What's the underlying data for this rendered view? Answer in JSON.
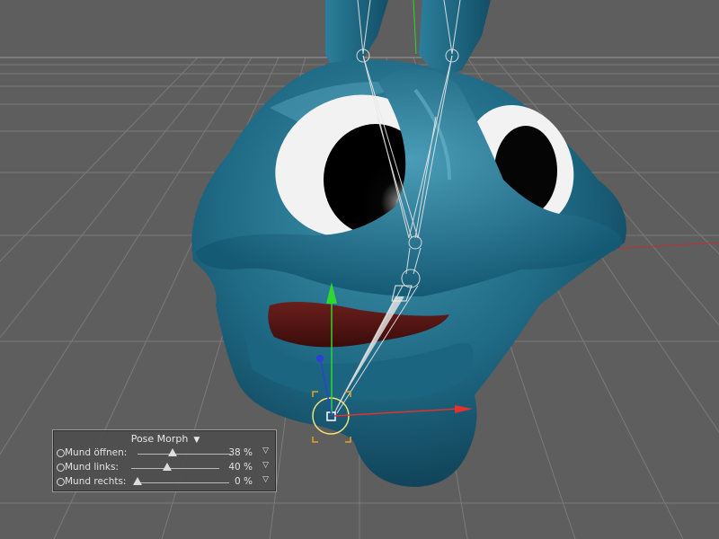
{
  "viewport": {
    "background_color": "#5e5e5e",
    "grid_color": "#7a7a7a",
    "model_color": "#1f6a85",
    "axis_x_color": "#e53030",
    "axis_y_color": "#2fd62f",
    "axis_z_color": "#2f3fd6"
  },
  "pose_morph_panel": {
    "title": "Pose Morph",
    "title_dropdown_icon": "triangle-down-icon",
    "sliders": [
      {
        "label": "Mund öffnen:",
        "value": 38,
        "value_text": "38 %",
        "track_start": 145,
        "track_end": 252
      },
      {
        "label": "Mund links:",
        "value": 40,
        "value_text": "40 %",
        "track_start": 145,
        "track_end": 246
      },
      {
        "label": "Mund rechts:",
        "value": 0,
        "value_text": "0 %",
        "track_start": 92,
        "track_end": 256
      }
    ]
  }
}
